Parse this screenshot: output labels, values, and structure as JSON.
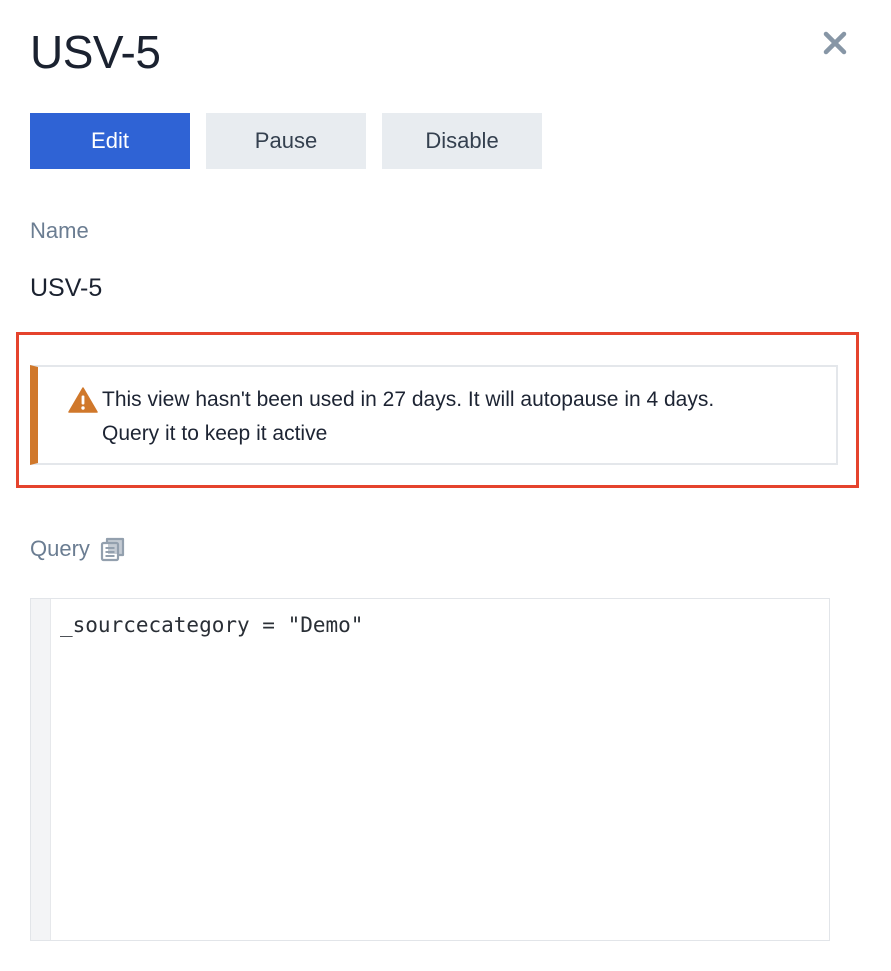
{
  "header": {
    "title": "USV-5",
    "close_icon": "close-icon"
  },
  "actions": {
    "edit_label": "Edit",
    "pause_label": "Pause",
    "disable_label": "Disable"
  },
  "name_field": {
    "label": "Name",
    "value": "USV-5"
  },
  "warning": {
    "icon": "warning-triangle-icon",
    "message": "This view hasn't been used in 27 days. It will autopause in 4 days. Query it to keep it active"
  },
  "query": {
    "label": "Query",
    "copy_icon": "copy-icon",
    "code": "_sourcecategory = \"Demo\""
  },
  "colors": {
    "primary": "#2f63d5",
    "secondary_button": "#e8ecf0",
    "warning_accent": "#d0782b",
    "highlight_border": "#e5432d",
    "label_text": "#6b7d92"
  }
}
